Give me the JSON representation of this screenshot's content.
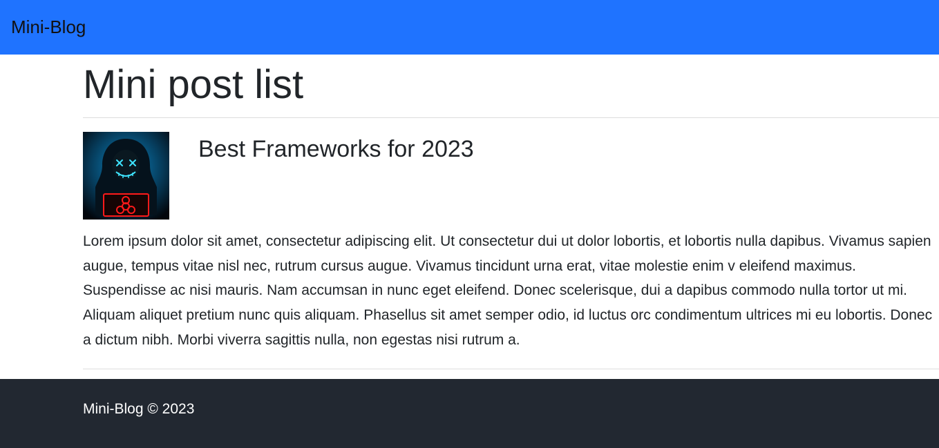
{
  "navbar": {
    "brand": "Mini-Blog"
  },
  "page": {
    "title": "Mini post list"
  },
  "posts": [
    {
      "title": "Best Frameworks for 2023",
      "body": "Lorem ipsum dolor sit amet, consectetur adipiscing elit. Ut consectetur dui ut dolor lobortis, et lobortis nulla dapibus. Vivamus sapien augue, tempus vitae nisl nec, rutrum cursus augue. Vivamus tincidunt urna erat, vitae molestie enim v eleifend maximus. Suspendisse ac nisi mauris. Nam accumsan in nunc eget eleifend. Donec scelerisque, dui a dapibus commodo nulla tortor ut mi. Aliquam aliquet pretium nunc quis aliquam. Phasellus sit amet semper odio, id luctus orc condimentum ultrices mi eu lobortis. Donec a dictum nibh. Morbi viverra sagittis nulla, non egestas nisi rutrum a.",
      "thumb_alt": "hacker-hoodie-thumbnail"
    }
  ],
  "footer": {
    "text": "Mini-Blog © 2023"
  }
}
